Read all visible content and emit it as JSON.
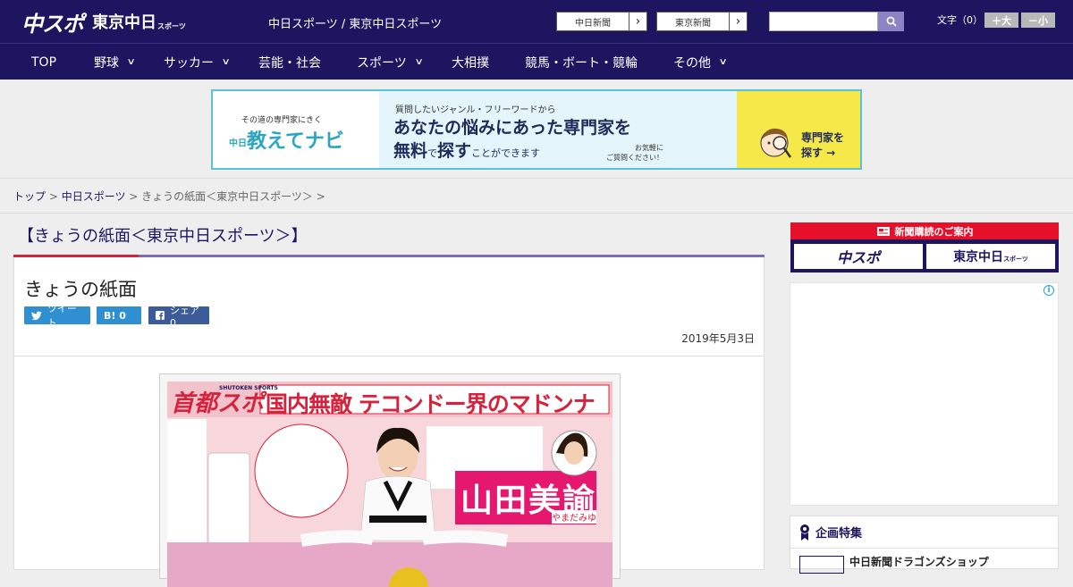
{
  "header": {
    "logo_chuspo": "中スポ",
    "logo_tokyo": "東京中日",
    "logo_tokyo_small": "スポーツ",
    "site_title": "中日スポーツ / 東京中日スポーツ",
    "paper_buttons": [
      {
        "label": "中日新聞",
        "arrow": "›"
      },
      {
        "label": "東京新聞",
        "arrow": "›"
      }
    ],
    "search_placeholder": "",
    "font_size_label": "文字（0）",
    "font_bigger": "＋大",
    "font_smaller": "－小"
  },
  "nav": {
    "items": [
      {
        "label": "TOP",
        "has_menu": false
      },
      {
        "label": "野球",
        "has_menu": true
      },
      {
        "label": "サッカー",
        "has_menu": true
      },
      {
        "label": "芸能・社会",
        "has_menu": false
      },
      {
        "label": "スポーツ",
        "has_menu": true
      },
      {
        "label": "大相撲",
        "has_menu": false
      },
      {
        "label": "競馬・ボート・競輪",
        "has_menu": false
      },
      {
        "label": "その他",
        "has_menu": true
      }
    ]
  },
  "banner": {
    "sub_copy": "その道の専門家にきく",
    "logo": "教えてナビ",
    "logo_prefix": "中日",
    "question": "質問したいジャンル・フリーワードから",
    "headline1": "あなたの悩みにあった専門家を",
    "headline2_a": "無料",
    "headline2_b": "で",
    "headline2_c": "探す",
    "headline2_d": "ことができます",
    "note1": "お気軽に",
    "note2": "ご質問ください！",
    "cta1": "専門家を",
    "cta2": "探す →"
  },
  "breadcrumb": {
    "home": "トップ",
    "sep": " > ",
    "section": "中日スポーツ",
    "current": "きょうの紙面＜東京中日スポーツ＞"
  },
  "page": {
    "section_title": "【きょうの紙面＜東京中日スポーツ＞】",
    "article_title": "きょうの紙面",
    "share_tweet": "ツイート",
    "share_hatena": "B! 0",
    "share_facebook": "シェア 0",
    "date": "2019年5月3日"
  },
  "newspaper": {
    "masthead": "首都スポ",
    "masthead_en": "SHUTOKEN SPORTS",
    "headline": "国内無敵 テコンドー界のマドンナ",
    "name": "山田美諭",
    "name_ruby": "やまだみゆ"
  },
  "sidebar": {
    "subscribe_title": "新聞購読のご案内",
    "subscribe_chuspo": "中スポ",
    "subscribe_tokyo": "東京中日",
    "subscribe_tokyo_small": "スポーツ",
    "ad_info": "i",
    "feature_title": "企画特集",
    "feature_item": "中日新聞ドラゴンズショップ"
  },
  "colors": {
    "brand_navy": "#1e1560",
    "accent_red": "#d5233d",
    "accent_purple": "#7c6cb8",
    "share_blue": "#2f8fd0"
  }
}
